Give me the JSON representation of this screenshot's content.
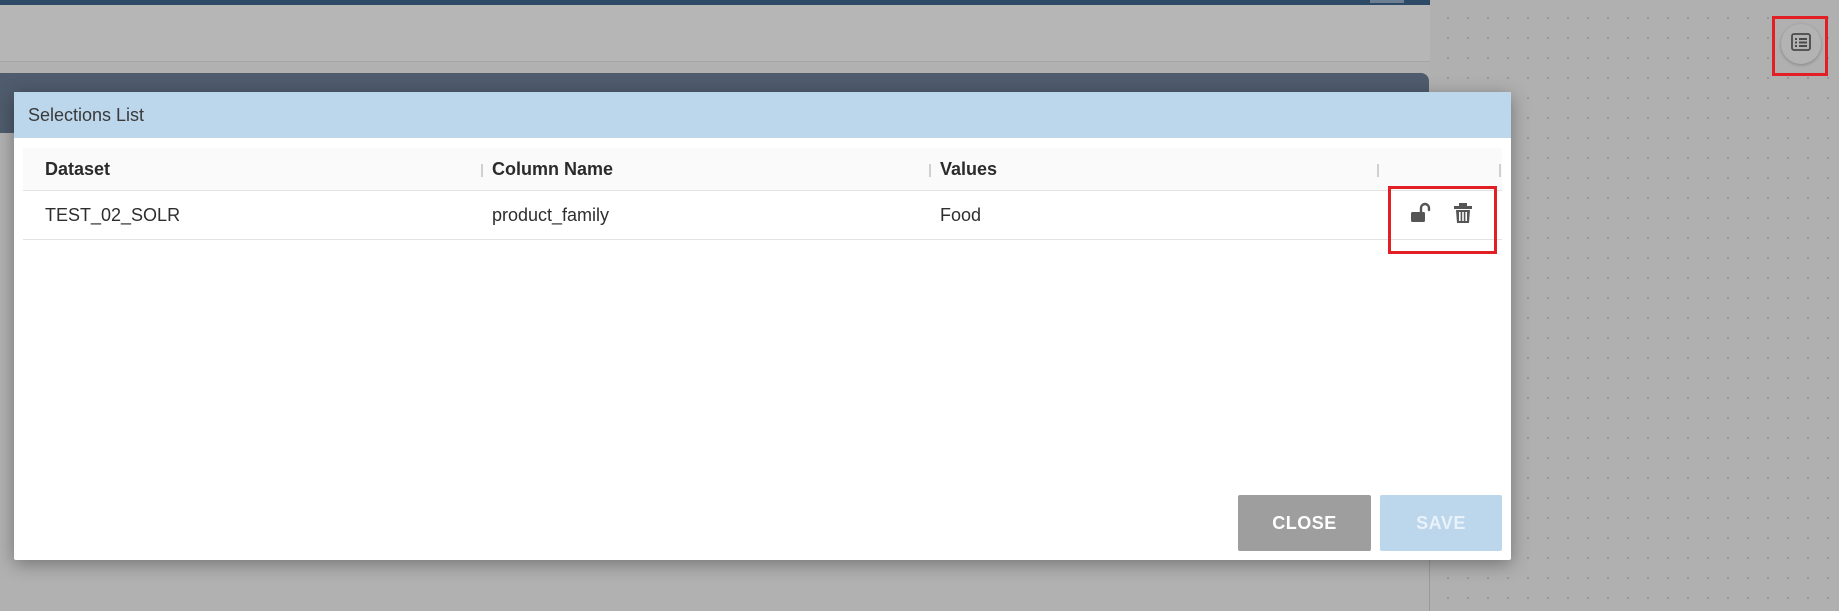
{
  "colors": {
    "modal_header_bg": "#bcd6ec",
    "highlight_border": "#e31f26",
    "close_button_bg": "#9e9e9e",
    "save_button_bg": "#bcd6ec"
  },
  "fab": {
    "icon": "list-icon"
  },
  "modal": {
    "title": "Selections List",
    "table": {
      "columns": [
        "Dataset",
        "Column Name",
        "Values",
        ""
      ],
      "rows": [
        {
          "dataset": "TEST_02_SOLR",
          "column_name": "product_family",
          "values": "Food",
          "actions": [
            "unlock-icon",
            "trash-icon"
          ]
        }
      ]
    },
    "buttons": {
      "close": "CLOSE",
      "save": "SAVE"
    }
  }
}
